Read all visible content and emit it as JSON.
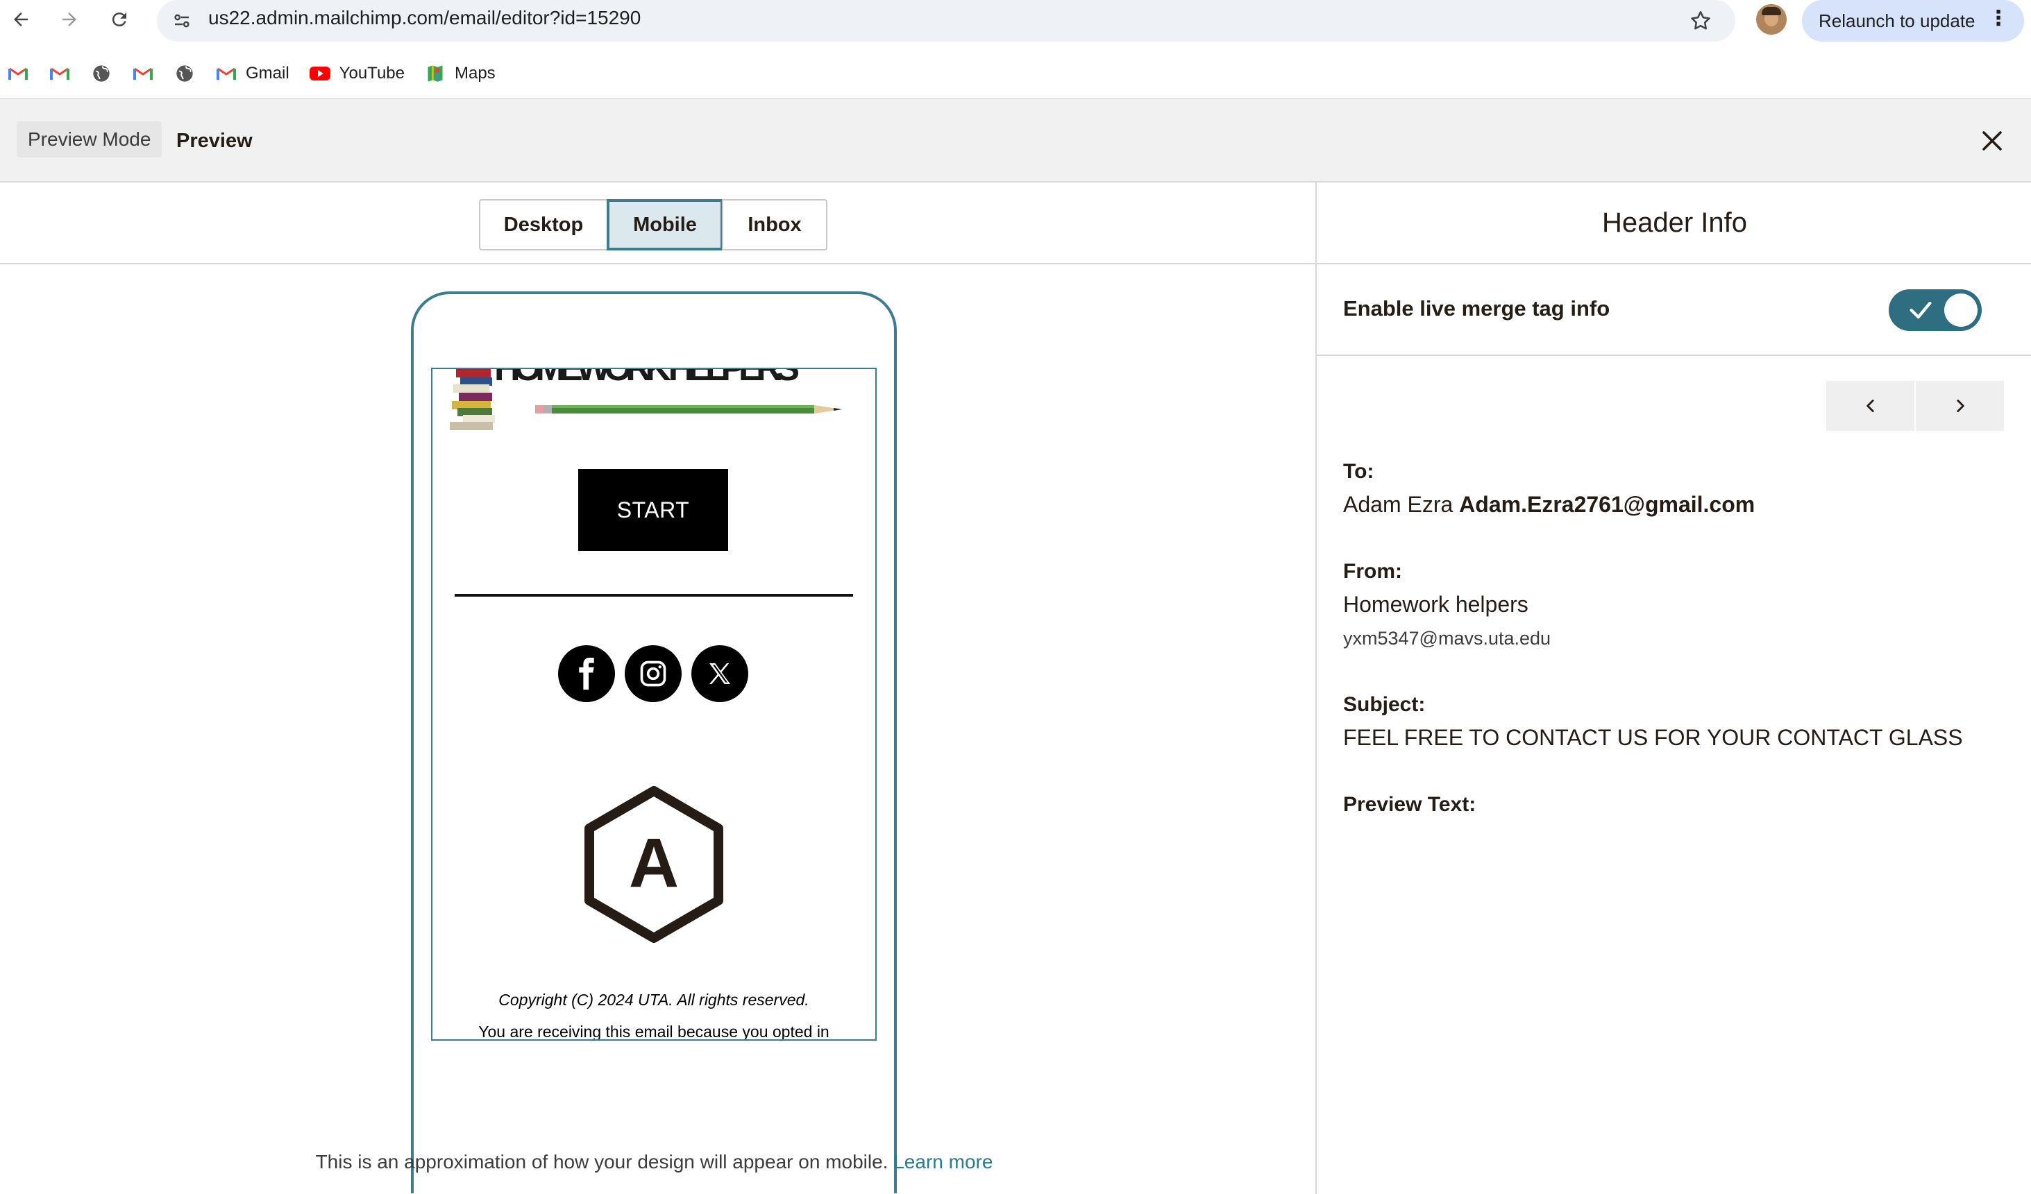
{
  "browser": {
    "url": "us22.admin.mailchimp.com/email/editor?id=15290",
    "relaunch_label": "Relaunch to update",
    "bookmarks": [
      {
        "label": "",
        "icon": "gmail-icon"
      },
      {
        "label": "",
        "icon": "gmail-icon"
      },
      {
        "label": "",
        "icon": "globe-icon"
      },
      {
        "label": "",
        "icon": "gmail-icon"
      },
      {
        "label": "",
        "icon": "globe-icon"
      },
      {
        "label": "Gmail",
        "icon": "gmail-icon"
      },
      {
        "label": "YouTube",
        "icon": "youtube-icon"
      },
      {
        "label": "Maps",
        "icon": "maps-icon"
      }
    ]
  },
  "header": {
    "mode_label": "Preview Mode",
    "title": "Preview"
  },
  "tabs": [
    {
      "label": "Desktop",
      "selected": false
    },
    {
      "label": "Mobile",
      "selected": true
    },
    {
      "label": "Inbox",
      "selected": false
    }
  ],
  "email": {
    "banner_text": "HOMEWORK HELPERS",
    "button_label": "START",
    "social": [
      "facebook",
      "instagram",
      "x"
    ],
    "logo_letter": "A",
    "copyright": "Copyright (C) 2024 UTA. All rights reserved.",
    "receiving": "You are receiving this email because you opted in"
  },
  "approx_note": {
    "text": "This is an approximation of how your design will appear on mobile.",
    "link": "Learn more"
  },
  "header_info": {
    "title": "Header Info",
    "merge_label": "Enable live merge tag info",
    "merge_enabled": true,
    "to_label": "To:",
    "to_name": "Adam Ezra",
    "to_email": "Adam.Ezra2761@gmail.com",
    "from_label": "From:",
    "from_name": "Homework helpers",
    "from_email": "yxm5347@mavs.uta.edu",
    "subject_label": "Subject:",
    "subject_value": "FEEL FREE TO CONTACT US FOR YOUR CONTACT GLASS",
    "preview_label": "Preview Text:",
    "preview_value": ""
  },
  "colors": {
    "accent": "#3d7c8f",
    "toggle": "#2e6e80",
    "link": "#2b7a8c"
  }
}
